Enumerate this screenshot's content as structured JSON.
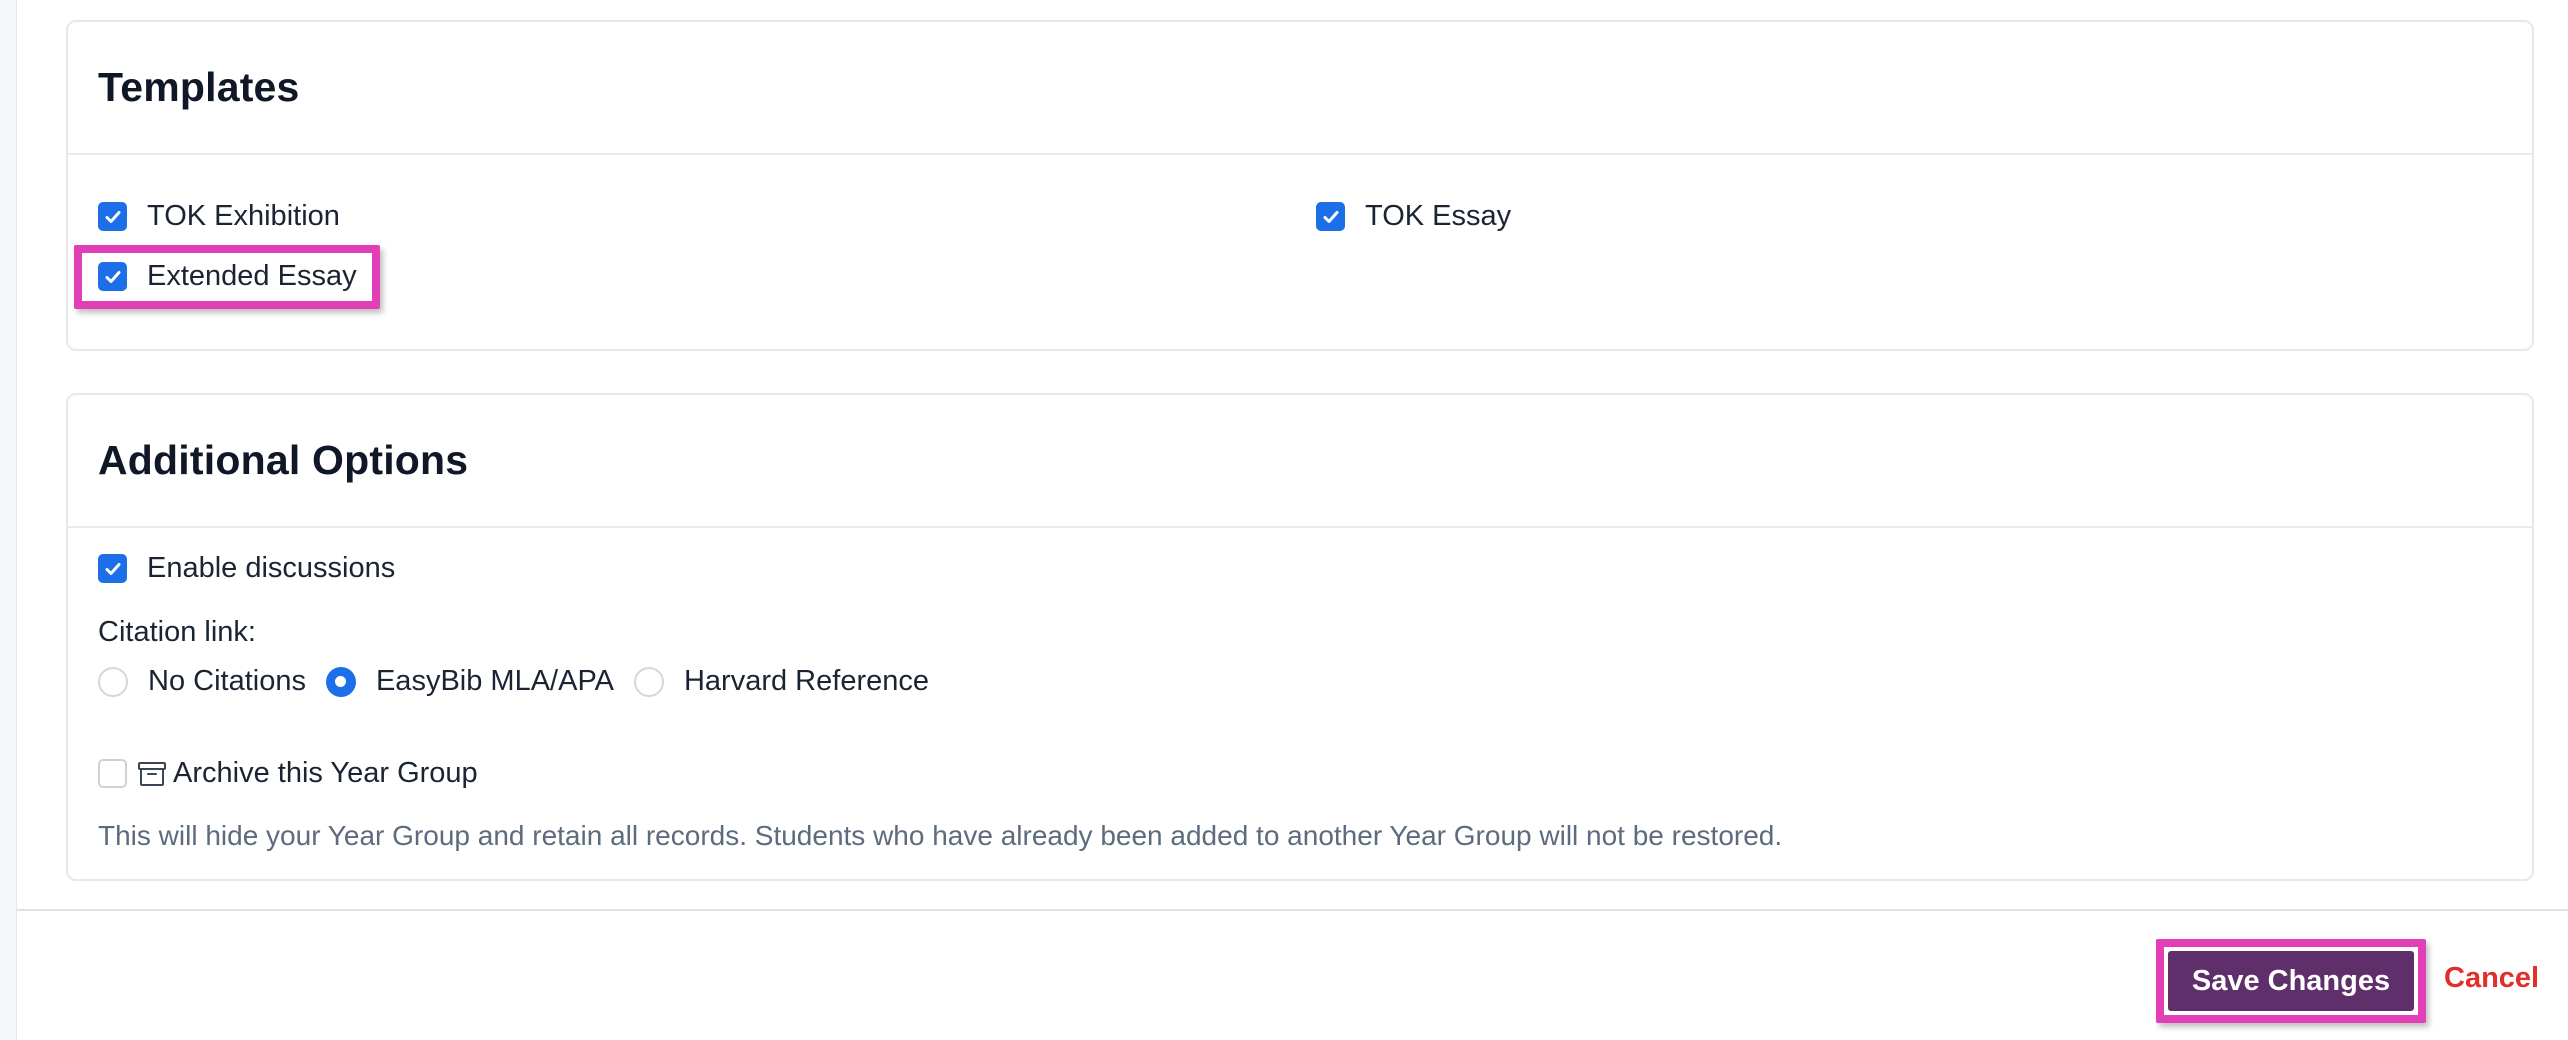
{
  "templates": {
    "title": "Templates",
    "items": [
      {
        "label": "TOK Exhibition",
        "checked": true
      },
      {
        "label": "TOK Essay",
        "checked": true
      },
      {
        "label": "Extended Essay",
        "checked": true
      }
    ]
  },
  "additional_options": {
    "title": "Additional Options",
    "enable_discussions": {
      "label": "Enable discussions",
      "checked": true
    },
    "citation": {
      "label": "Citation link:",
      "options": [
        {
          "label": "No Citations",
          "selected": false
        },
        {
          "label": "EasyBib MLA/APA",
          "selected": true
        },
        {
          "label": "Harvard Reference",
          "selected": false
        }
      ]
    },
    "archive": {
      "label": "Archive this Year Group",
      "icon": "archive-icon",
      "checked": false,
      "help": "This will hide your Year Group and retain all records. Students who have already been added to another Year Group will not be restored."
    }
  },
  "footer": {
    "save_label": "Save Changes",
    "cancel_label": "Cancel"
  },
  "colors": {
    "accent": "#1c6fe8",
    "save_button": "#5e2f6b",
    "cancel": "#e0302b",
    "highlight": "#e23fb7"
  }
}
